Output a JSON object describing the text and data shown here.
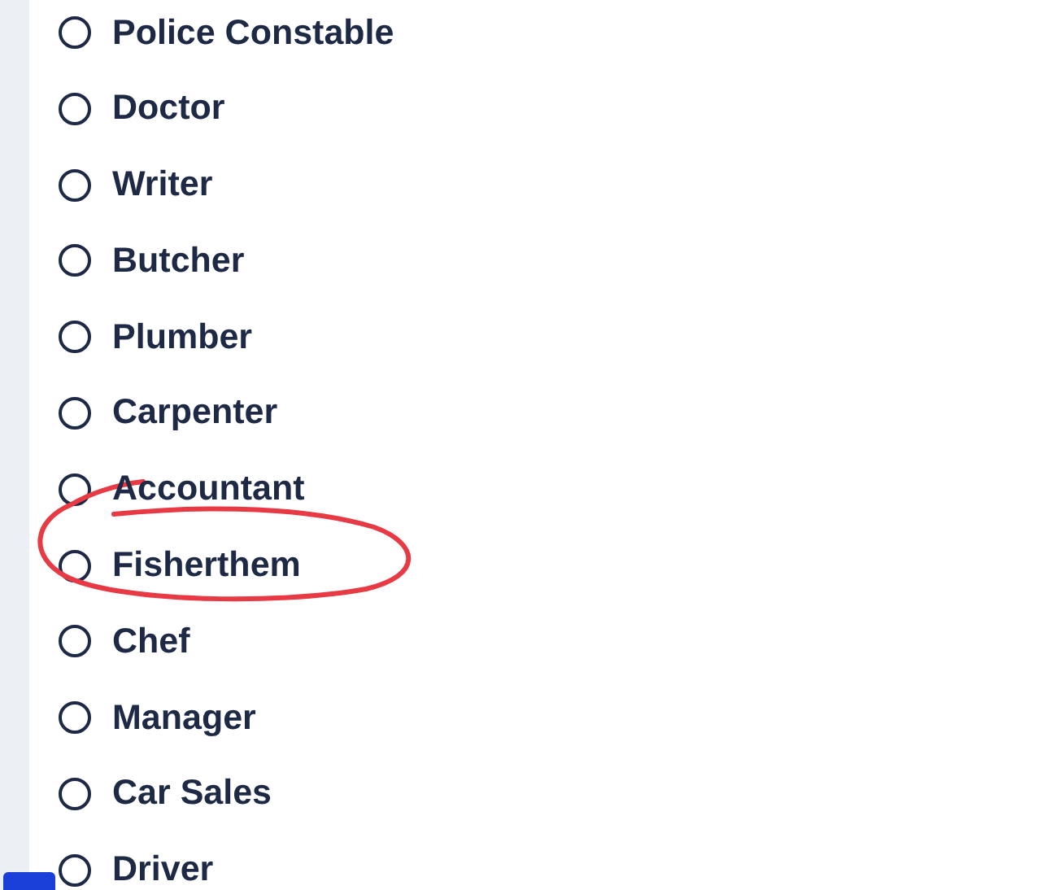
{
  "options": [
    {
      "label": "Police Constable",
      "selected": false,
      "circled": false
    },
    {
      "label": "Doctor",
      "selected": false,
      "circled": false
    },
    {
      "label": "Writer",
      "selected": false,
      "circled": false
    },
    {
      "label": "Butcher",
      "selected": false,
      "circled": false
    },
    {
      "label": "Plumber",
      "selected": false,
      "circled": false
    },
    {
      "label": "Carpenter",
      "selected": false,
      "circled": false
    },
    {
      "label": "Accountant",
      "selected": false,
      "circled": false
    },
    {
      "label": "Fisherthem",
      "selected": false,
      "circled": true
    },
    {
      "label": "Chef",
      "selected": false,
      "circled": false
    },
    {
      "label": "Manager",
      "selected": false,
      "circled": false
    },
    {
      "label": "Car Sales",
      "selected": false,
      "circled": false
    },
    {
      "label": "Driver",
      "selected": false,
      "circled": false
    }
  ]
}
